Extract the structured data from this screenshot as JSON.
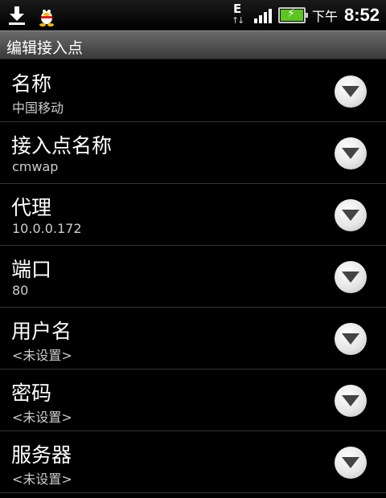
{
  "status_bar": {
    "left_icons": [
      "download-icon",
      "qq-icon"
    ],
    "network_type": "E",
    "ampm": "下午",
    "time": "8:52"
  },
  "title": "编辑接入点",
  "items": [
    {
      "label": "名称",
      "value": "中国移动"
    },
    {
      "label": "接入点名称",
      "value": "cmwap"
    },
    {
      "label": "代理",
      "value": "10.0.0.172"
    },
    {
      "label": "端口",
      "value": "80"
    },
    {
      "label": "用户名",
      "value": "<未设置>"
    },
    {
      "label": "密码",
      "value": "<未设置>"
    },
    {
      "label": "服务器",
      "value": "<未设置>"
    }
  ],
  "colors": {
    "battery": "#5cc620",
    "title_bar": "#4a4a4a"
  }
}
